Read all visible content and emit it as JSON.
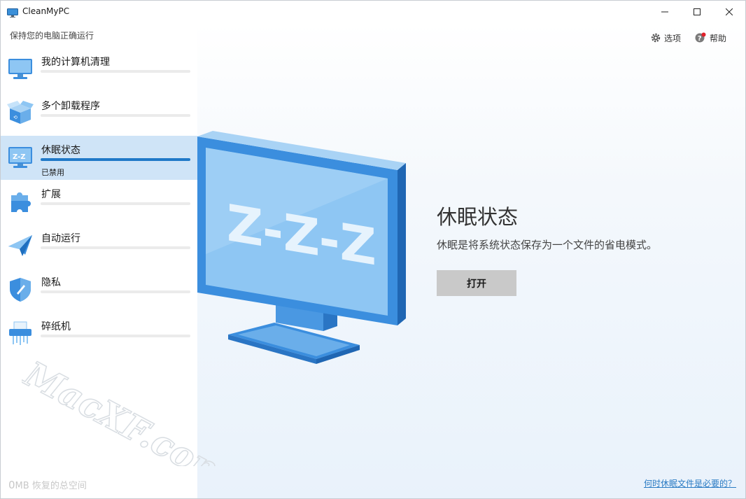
{
  "window": {
    "title": "CleanMyPC",
    "icon": "monitor-icon"
  },
  "sidebar": {
    "tagline": "保持您的电脑正确运行",
    "items": [
      {
        "label": "我的计算机清理",
        "icon": "computer-icon",
        "status": ""
      },
      {
        "label": "多个卸载程序",
        "icon": "box-icon",
        "status": ""
      },
      {
        "label": "休眠状态",
        "icon": "sleep-monitor-icon",
        "status": "已禁用"
      },
      {
        "label": "扩展",
        "icon": "puzzle-icon",
        "status": ""
      },
      {
        "label": "自动运行",
        "icon": "paper-plane-icon",
        "status": ""
      },
      {
        "label": "隐私",
        "icon": "shield-icon",
        "status": ""
      },
      {
        "label": "碎纸机",
        "icon": "shredder-icon",
        "status": ""
      }
    ],
    "active_index": 2,
    "footer": {
      "amount": "0",
      "unit": "MB",
      "label": "恢复的总空间"
    }
  },
  "header": {
    "options_label": "选项",
    "help_label": "帮助"
  },
  "main": {
    "title": "休眠状态",
    "description": "休眠是将系统状态保存为一个文件的省电模式。",
    "button_label": "打开",
    "help_link": "何时休眠文件是必要的？",
    "monitor_text": "Z-Z-Z"
  },
  "watermark": {
    "text": "MacXF.com"
  },
  "colors": {
    "accent": "#2079c8",
    "active_bg": "#cfe4f7",
    "button_bg": "#c9c9c9",
    "link": "#2a7bc4"
  }
}
